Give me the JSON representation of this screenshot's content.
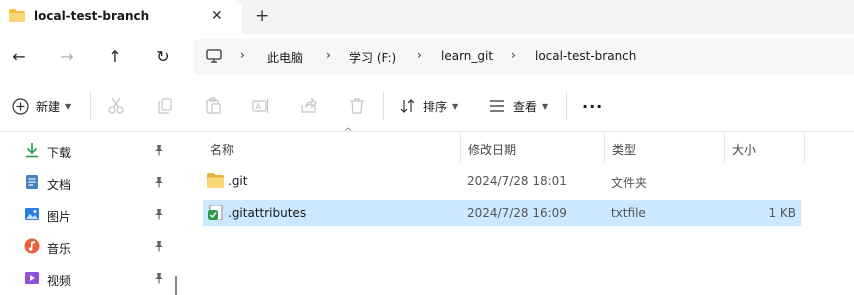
{
  "tab": {
    "title": "local-test-branch",
    "close": "✕",
    "new_tab": "+"
  },
  "nav": {
    "back": "←",
    "forward": "→",
    "up": "↑",
    "refresh": "↻"
  },
  "breadcrumb": {
    "items": [
      "此电脑",
      "学习 (F:)",
      "learn_git",
      "local-test-branch"
    ],
    "separator": "›"
  },
  "toolbar": {
    "new_label": "新建",
    "sort_label": "排序",
    "view_label": "查看",
    "more_label": "···"
  },
  "sidebar": {
    "items": [
      {
        "label": "下载",
        "icon": "download-icon"
      },
      {
        "label": "文档",
        "icon": "document-icon"
      },
      {
        "label": "图片",
        "icon": "picture-icon"
      },
      {
        "label": "音乐",
        "icon": "music-icon"
      },
      {
        "label": "视频",
        "icon": "video-icon"
      }
    ]
  },
  "columns": {
    "name": "名称",
    "date": "修改日期",
    "type": "类型",
    "size": "大小"
  },
  "files": [
    {
      "name": ".git",
      "date": "2024/7/28 18:01",
      "type": "文件夹",
      "size": "",
      "icon": "folder-icon",
      "selected": false
    },
    {
      "name": ".gitattributes",
      "date": "2024/7/28 16:09",
      "type": "txtfile",
      "size": "1 KB",
      "icon": "text-file-icon",
      "selected": true
    }
  ],
  "colors": {
    "accent": "#0067c0",
    "selection": "#cce8ff",
    "folder": "#f3c13d"
  }
}
